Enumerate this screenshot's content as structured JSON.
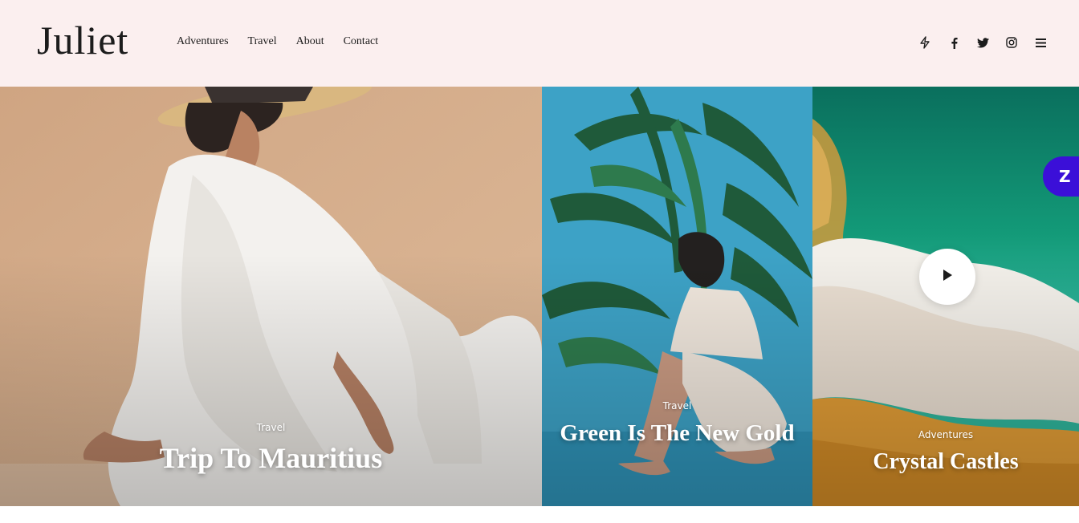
{
  "header": {
    "logo": "Juliet",
    "nav": [
      "Adventures",
      "Travel",
      "About",
      "Contact"
    ],
    "icons": [
      "bolt-icon",
      "facebook-icon",
      "twitter-icon",
      "instagram-icon",
      "menu-icon"
    ],
    "background": "#fbefef"
  },
  "posts": [
    {
      "category": "Travel",
      "title": "Trip To Mauritius",
      "palette": [
        "#d9b392",
        "#f4f2ef"
      ]
    },
    {
      "category": "Travel",
      "title": "Green Is The New Gold",
      "palette": [
        "#3fa3c6",
        "#1f5a3a"
      ]
    },
    {
      "category": "Adventures",
      "title": "Crystal Castles",
      "palette": [
        "#0e8a6c",
        "#e0a23a"
      ],
      "has_video": true
    }
  ],
  "chat_badge": {
    "label": "Z",
    "color": "#3b0fd8"
  },
  "icons": {
    "play": "play-icon"
  }
}
